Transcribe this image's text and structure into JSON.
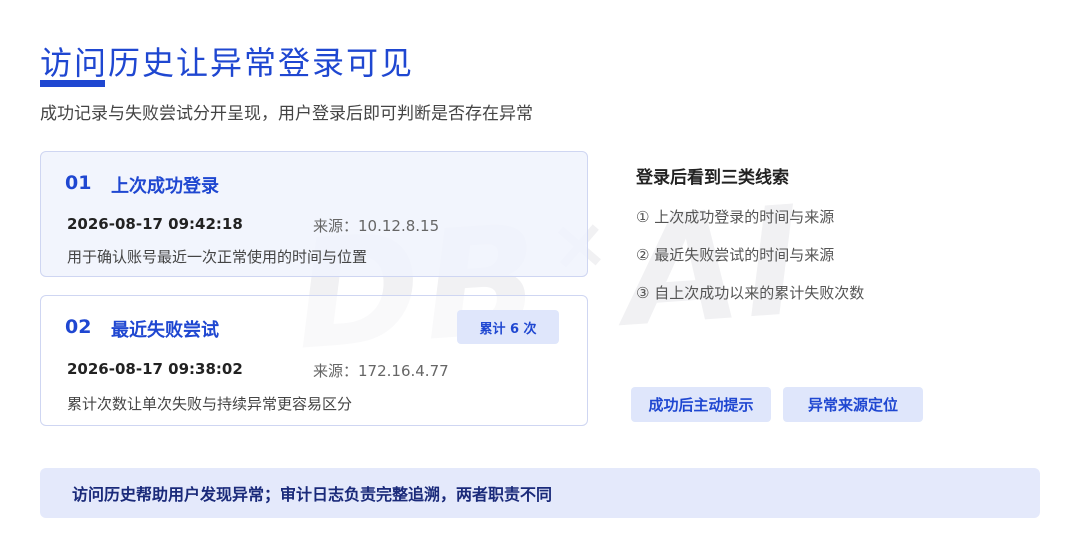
{
  "header": {
    "title": "访问历史让异常登录可见",
    "subtitle": "成功记录与失败尝试分开呈现，用户登录后即可判断是否存在异常"
  },
  "cards": [
    {
      "num": "01",
      "title": "上次成功登录",
      "time": "2026-08-17  09:42:18",
      "source": "来源：10.12.8.15",
      "desc": "用于确认账号最近一次正常使用的时间与位置"
    },
    {
      "num": "02",
      "title": "最近失败尝试",
      "badge": "累计 6 次",
      "time": "2026-08-17  09:38:02",
      "source": "来源：172.16.4.77",
      "desc": "累计次数让单次失败与持续异常更容易区分"
    }
  ],
  "clues": {
    "title": "登录后看到三类线索",
    "items": [
      "① 上次成功登录的时间与来源",
      "② 最近失败尝试的时间与来源",
      "③ 自上次成功以来的累计失败次数"
    ]
  },
  "chips": [
    "成功后主动提示",
    "异常来源定位"
  ],
  "footer": {
    "text": "访问历史帮助用户发现异常；审计日志负责完整追溯，两者职责不同"
  },
  "watermark": {
    "left": "DB",
    "mid": "×",
    "right": "AI"
  },
  "colors": {
    "accent": "#1f47d1",
    "chip_bg": "#dfe6fb",
    "footer_bg": "#e4e9fb",
    "card_border": "#cfd6f2"
  }
}
